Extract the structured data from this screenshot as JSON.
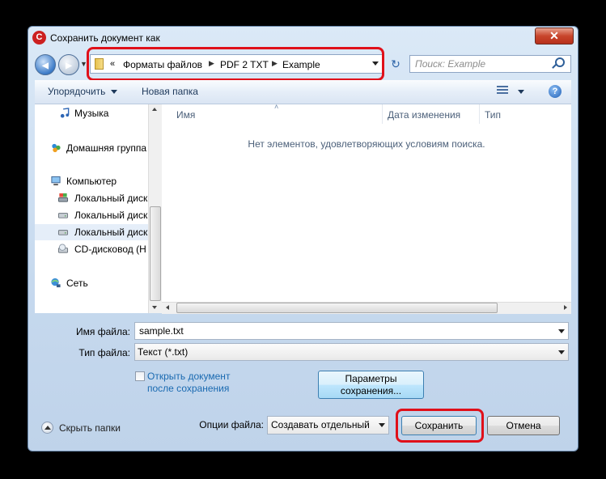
{
  "window": {
    "title": "Сохранить документ как",
    "close_label": "✕"
  },
  "nav": {
    "back_label": "◀",
    "forward_label": "▶",
    "breadcrumb_prefix": "«",
    "breadcrumbs": [
      "Форматы файлов",
      "PDF 2 TXT",
      "Example"
    ],
    "separator": "▶",
    "refresh_label": "↻"
  },
  "search": {
    "placeholder": "Поиск: Example"
  },
  "toolbar": {
    "organize_label": "Упорядочить",
    "new_folder_label": "Новая папка",
    "help_label": "?"
  },
  "sidebar": {
    "items": [
      {
        "label": "Музыка",
        "icon": "music-icon"
      },
      {
        "label": "Домашняя группа",
        "icon": "homegroup-icon"
      },
      {
        "label": "Компьютер",
        "icon": "computer-icon"
      },
      {
        "label": "Локальный диск",
        "icon": "drive-icon"
      },
      {
        "label": "Локальный диск",
        "icon": "drive-icon"
      },
      {
        "label": "Локальный диск",
        "icon": "drive-icon"
      },
      {
        "label": "CD-дисковод (H",
        "icon": "cd-drive-icon"
      },
      {
        "label": "Сеть",
        "icon": "network-icon"
      }
    ]
  },
  "file_list": {
    "columns": [
      "Имя",
      "Дата изменения",
      "Тип"
    ],
    "empty_message": "Нет элементов, удовлетворяющих условиям поиска."
  },
  "form": {
    "filename_label": "Имя файла:",
    "filename_value": "sample.txt",
    "filetype_label": "Тип файла:",
    "filetype_value": "Текст (*.txt)",
    "open_after_save_line1": "Открыть документ",
    "open_after_save_line2": "после сохранения",
    "open_after_save_checked": false,
    "params_button_line1": "Параметры",
    "params_button_line2": "сохранения...",
    "file_options_label": "Опции файла:",
    "file_options_value": "Создавать отдельный ф"
  },
  "footer": {
    "hide_folders_label": "Скрыть папки",
    "save_label": "Сохранить",
    "cancel_label": "Отмена"
  },
  "colors": {
    "highlight": "#e0101a",
    "link": "#1a6ab1",
    "title_bar": "#c6d9ee"
  }
}
